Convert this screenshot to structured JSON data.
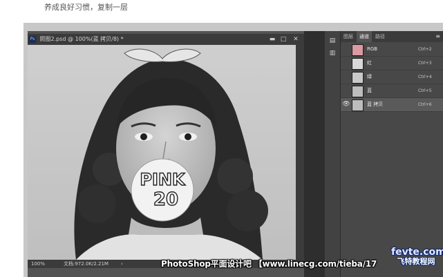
{
  "caption": "养成良好习惯，复制一层",
  "document": {
    "badge": "Ps",
    "tab_title": "照图2.psd @ 100%(蓝 拷贝/8) *",
    "minimize": "▬",
    "restore": "□",
    "close": "✕",
    "sticker_line1": "PINK",
    "sticker_line2": "20"
  },
  "status": {
    "zoom": "100%",
    "doc_size": "文档:972.0K/2.21M",
    "arrow": "›"
  },
  "panel": {
    "tabs": [
      "图层",
      "通道",
      "路径"
    ],
    "active_tab": 1,
    "menu_icon": "≡",
    "channels": [
      {
        "name": "RGB",
        "shortcut": "Ctrl+2",
        "eye": "",
        "color": "#d99aa2"
      },
      {
        "name": "红",
        "shortcut": "Ctrl+3",
        "eye": "",
        "color": "#d8d8d8"
      },
      {
        "name": "绿",
        "shortcut": "Ctrl+4",
        "eye": "",
        "color": "#c9c9c9"
      },
      {
        "name": "蓝",
        "shortcut": "Ctrl+5",
        "eye": "",
        "color": "#bdbdbd"
      },
      {
        "name": "蓝 拷贝",
        "shortcut": "Ctrl+6",
        "eye": "👁",
        "color": "#bdbdbd"
      }
    ]
  },
  "watermark": "PhotoShop平面设计吧 【www.linecg.com/tieba/17",
  "brand": {
    "line1": "fevte.com",
    "line2": "飞特教程网"
  }
}
